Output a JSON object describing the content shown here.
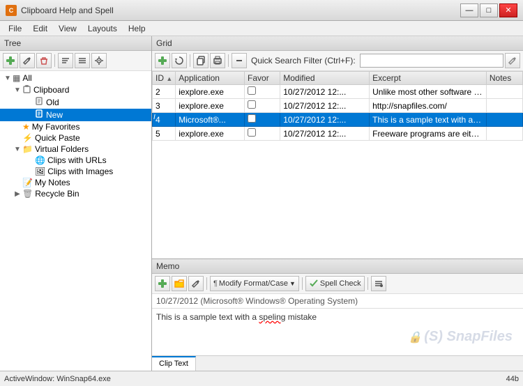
{
  "titlebar": {
    "title": "Clipboard Help and Spell",
    "icon_label": "C",
    "minimize_label": "—",
    "maximize_label": "□",
    "close_label": "✕"
  },
  "menubar": {
    "items": [
      {
        "label": "File"
      },
      {
        "label": "Edit"
      },
      {
        "label": "View"
      },
      {
        "label": "Layouts"
      },
      {
        "label": "Help"
      }
    ]
  },
  "tree": {
    "header": "Tree",
    "toolbar_buttons": [
      {
        "icon": "⊕",
        "tooltip": "Add"
      },
      {
        "icon": "✎",
        "tooltip": "Edit"
      },
      {
        "icon": "✖",
        "tooltip": "Delete"
      },
      {
        "icon": "≡",
        "tooltip": "Sort"
      },
      {
        "icon": "☰",
        "tooltip": "More"
      },
      {
        "icon": "⚙",
        "tooltip": "Settings"
      }
    ],
    "items": [
      {
        "id": "all",
        "label": "All",
        "level": 0,
        "expanded": true,
        "icon": "▦"
      },
      {
        "id": "clipboard",
        "label": "Clipboard",
        "level": 1,
        "expanded": true,
        "icon": "📋"
      },
      {
        "id": "old",
        "label": "Old",
        "level": 2,
        "icon": "📄"
      },
      {
        "id": "new",
        "label": "New",
        "level": 2,
        "icon": "📄",
        "selected": true
      },
      {
        "id": "favorites",
        "label": "My Favorites",
        "level": 1,
        "icon": "⭐"
      },
      {
        "id": "quickpaste",
        "label": "Quick Paste",
        "level": 1,
        "icon": "⚡"
      },
      {
        "id": "virtual",
        "label": "Virtual Folders",
        "level": 1,
        "expanded": true,
        "icon": "📁"
      },
      {
        "id": "clipurls",
        "label": "Clips with URLs",
        "level": 2,
        "icon": "🌐"
      },
      {
        "id": "clipimages",
        "label": "Clips with Images",
        "level": 2,
        "icon": "🖼"
      },
      {
        "id": "notes",
        "label": "My Notes",
        "level": 1,
        "icon": "📝"
      },
      {
        "id": "recycle",
        "label": "Recycle Bin",
        "level": 1,
        "expanded": false,
        "icon": "🗑",
        "has_expand": true
      }
    ]
  },
  "grid": {
    "header": "Grid",
    "search_placeholder": "Quick Search Filter (Ctrl+F):",
    "search_value": "",
    "columns": [
      {
        "id": "id",
        "label": "ID"
      },
      {
        "id": "application",
        "label": "Application"
      },
      {
        "id": "favor",
        "label": "Favor"
      },
      {
        "id": "modified",
        "label": "Modified"
      },
      {
        "id": "excerpt",
        "label": "Excerpt"
      },
      {
        "id": "notes",
        "label": "Notes"
      }
    ],
    "rows": [
      {
        "id": "2",
        "flag": "",
        "application": "iexplore.exe",
        "favor": false,
        "modified": "10/27/2012 12:...",
        "excerpt": "Unlike most other software download site...",
        "notes": "",
        "selected": false
      },
      {
        "id": "3",
        "flag": "",
        "application": "iexplore.exe",
        "favor": false,
        "modified": "10/27/2012 12:...",
        "excerpt": "http://snapfiles.com/",
        "notes": "",
        "selected": false
      },
      {
        "id": "4",
        "flag": "I",
        "application": "Microsoft®...",
        "favor": false,
        "modified": "10/27/2012 12:...",
        "excerpt": "This is a sample text with a speling mistake",
        "notes": "",
        "selected": true
      },
      {
        "id": "5",
        "flag": "",
        "application": "iexplore.exe",
        "favor": false,
        "modified": "10/27/2012 12:...",
        "excerpt": "Freeware programs are either distributed f...",
        "notes": "",
        "selected": false
      }
    ]
  },
  "memo": {
    "header": "Memo",
    "date_line": "10/27/2012 (Microsoft® Windows® Operating System)",
    "text_content": "This is a sample text with a speling mistake",
    "misspelled_word": "speling",
    "watermark": "(S) SnapFiles",
    "tabs": [
      {
        "label": "Clip Text",
        "active": true
      }
    ],
    "format_btn": "Modify Format/Case",
    "spell_btn": "Spell Check"
  },
  "statusbar": {
    "left_text": "ActiveWindow: WinSnap64.exe",
    "right_text": "44b"
  },
  "icons": {
    "add": "⊕",
    "edit": "✏",
    "delete": "🗑",
    "nav_forward": "➤",
    "nav_back": "◀",
    "copy": "⧉",
    "print": "🖨",
    "separator": "—",
    "pencil": "✏",
    "green_plus": "➕",
    "yellow_folder": "📂",
    "lightning": "⚡",
    "format": "¶",
    "spell": "✓"
  }
}
